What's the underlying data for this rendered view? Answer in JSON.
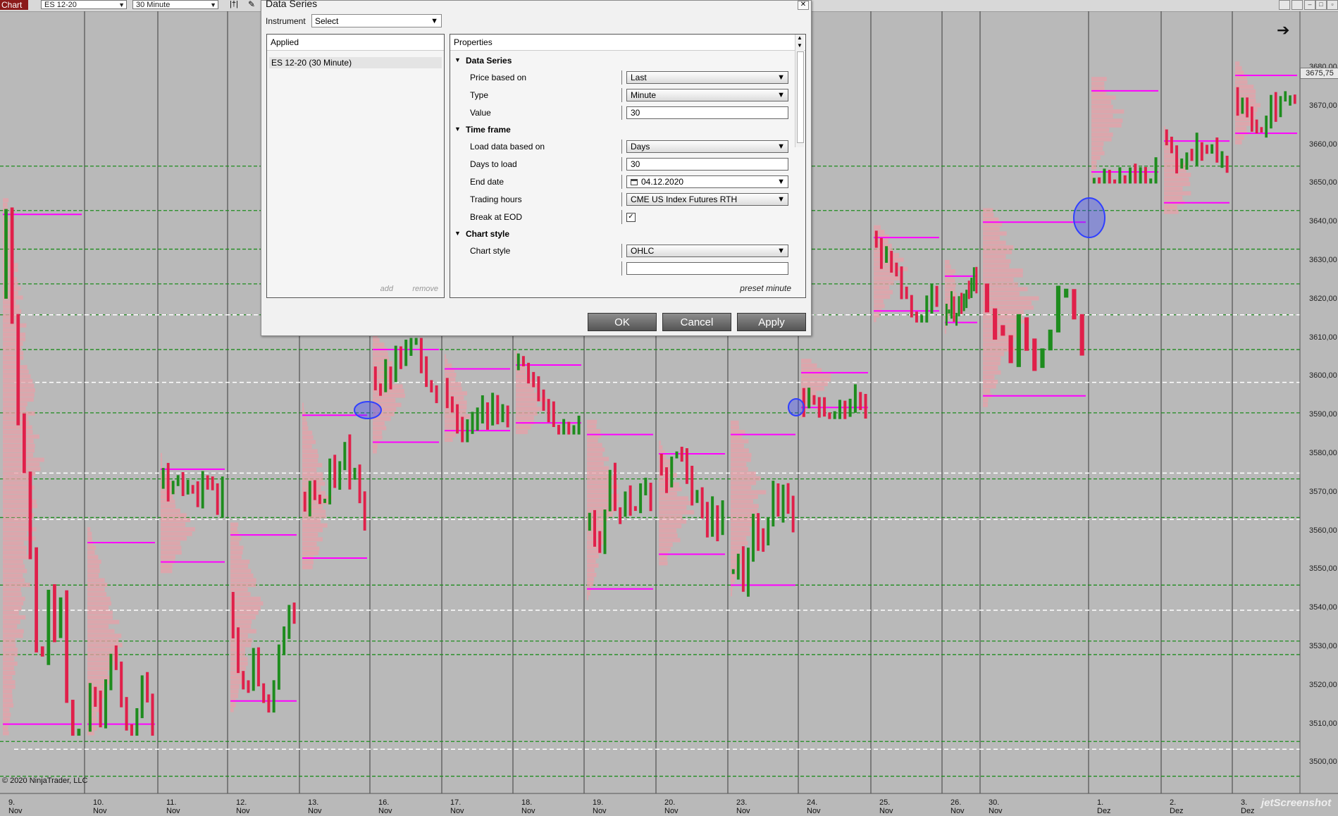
{
  "topbar": {
    "tab_label": "Chart",
    "instrument_value": "ES 12-20",
    "interval_value": "30 Minute"
  },
  "dialog": {
    "title": "Data Series",
    "instrument_label": "Instrument",
    "instrument_select": "Select",
    "applied_header": "Applied",
    "applied_item": "ES 12-20 (30 Minute)",
    "add_label": "add",
    "remove_label": "remove",
    "properties_header": "Properties",
    "preset_label": "preset minute",
    "ok_label": "OK",
    "cancel_label": "Cancel",
    "apply_label": "Apply",
    "categories": {
      "data_series": "Data Series",
      "time_frame": "Time frame",
      "chart_style": "Chart style"
    },
    "fields": {
      "price_based_on": {
        "label": "Price based on",
        "value": "Last"
      },
      "type": {
        "label": "Type",
        "value": "Minute"
      },
      "value": {
        "label": "Value",
        "value": "30"
      },
      "load_data_based_on": {
        "label": "Load data based on",
        "value": "Days"
      },
      "days_to_load": {
        "label": "Days to load",
        "value": "30"
      },
      "end_date": {
        "label": "End date",
        "value": "04.12.2020"
      },
      "trading_hours": {
        "label": "Trading hours",
        "value": "CME US Index Futures RTH"
      },
      "break_at_eod": {
        "label": "Break at EOD",
        "checked": true
      },
      "chart_style": {
        "label": "Chart style",
        "value": "OHLC"
      }
    }
  },
  "chart": {
    "current_price": "3675,75",
    "copyright": "© 2020 NinjaTrader, LLC",
    "watermark": "jetScreenshot",
    "price_axis": [
      "3680,00",
      "3670,00",
      "3660,00",
      "3650,00",
      "3640,00",
      "3630,00",
      "3620,00",
      "3610,00",
      "3600,00",
      "3590,00",
      "3580,00",
      "3570,00",
      "3560,00",
      "3550,00",
      "3540,00",
      "3530,00",
      "3520,00",
      "3510,00",
      "3500,00"
    ],
    "dates": [
      "9. Nov",
      "10. Nov",
      "11. Nov",
      "12. Nov",
      "13. Nov",
      "16. Nov",
      "17. Nov",
      "18. Nov",
      "19. Nov",
      "20. Nov",
      "23. Nov",
      "24. Nov",
      "25. Nov",
      "26. Nov",
      "30. Nov",
      "1. Dez",
      "2. Dez",
      "3. Dez"
    ],
    "colors": {
      "background": "#b9b9b9",
      "up_bar": "#1e8c1e",
      "down_bar": "#e0204a",
      "profile": "#e8a0a8",
      "value_area": "#ff00ff",
      "poc_line": "#ffffff",
      "level_line": "#1e8c1e",
      "marker": "#3040ff"
    }
  }
}
